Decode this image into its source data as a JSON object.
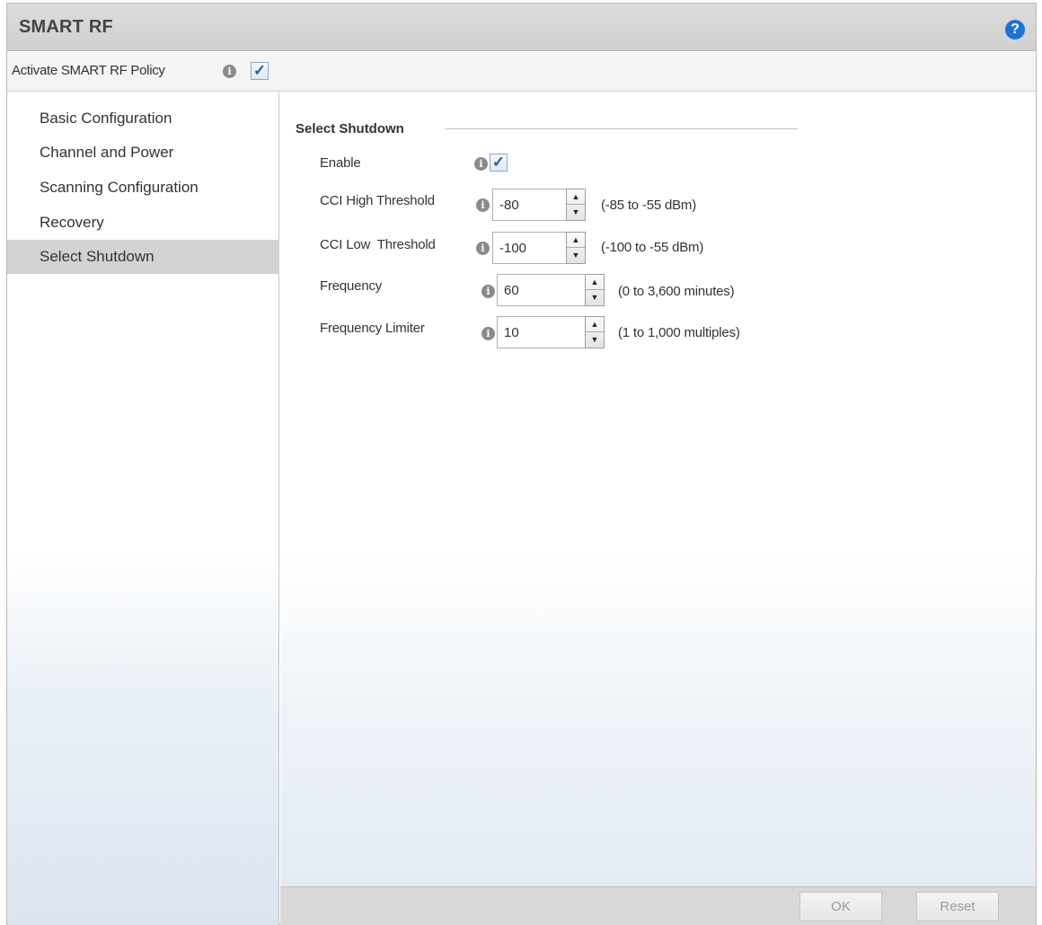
{
  "window": {
    "title": "SMART RF",
    "help_icon": "question-circle-icon",
    "help_glyph": "?"
  },
  "activate": {
    "label": "Activate SMART RF Policy",
    "checked": true,
    "check_glyph": "✓"
  },
  "info_glyph": "i",
  "sidebar": {
    "items": [
      {
        "label": "Basic Configuration",
        "selected": false
      },
      {
        "label": "Channel and Power",
        "selected": false
      },
      {
        "label": "Scanning Configuration",
        "selected": false
      },
      {
        "label": "Recovery",
        "selected": false
      },
      {
        "label": "Select Shutdown",
        "selected": true
      }
    ]
  },
  "main": {
    "section_title": "Select Shutdown",
    "enable": {
      "label": "Enable",
      "checked": true,
      "check_glyph": "✓"
    },
    "fields": [
      {
        "label": "CCI High Threshold",
        "value": "-80",
        "range": "(-85 to -55 dBm)"
      },
      {
        "label": "CCI Low  Threshold",
        "value": "-100",
        "range": "(-100 to -55 dBm)"
      },
      {
        "label": "Frequency",
        "value": "60",
        "range": "(0 to 3,600 minutes)"
      },
      {
        "label": "Frequency Limiter",
        "value": "10",
        "range": "(1 to 1,000 multiples)"
      }
    ],
    "spinner_up_glyph": "▲",
    "spinner_down_glyph": "▼"
  },
  "footer": {
    "ok_label": "OK",
    "reset_label": "Reset"
  },
  "colors": {
    "accent": "#1d73d6",
    "selected_nav": "#d3d3d3",
    "titlebar": "#d6d6d6"
  }
}
